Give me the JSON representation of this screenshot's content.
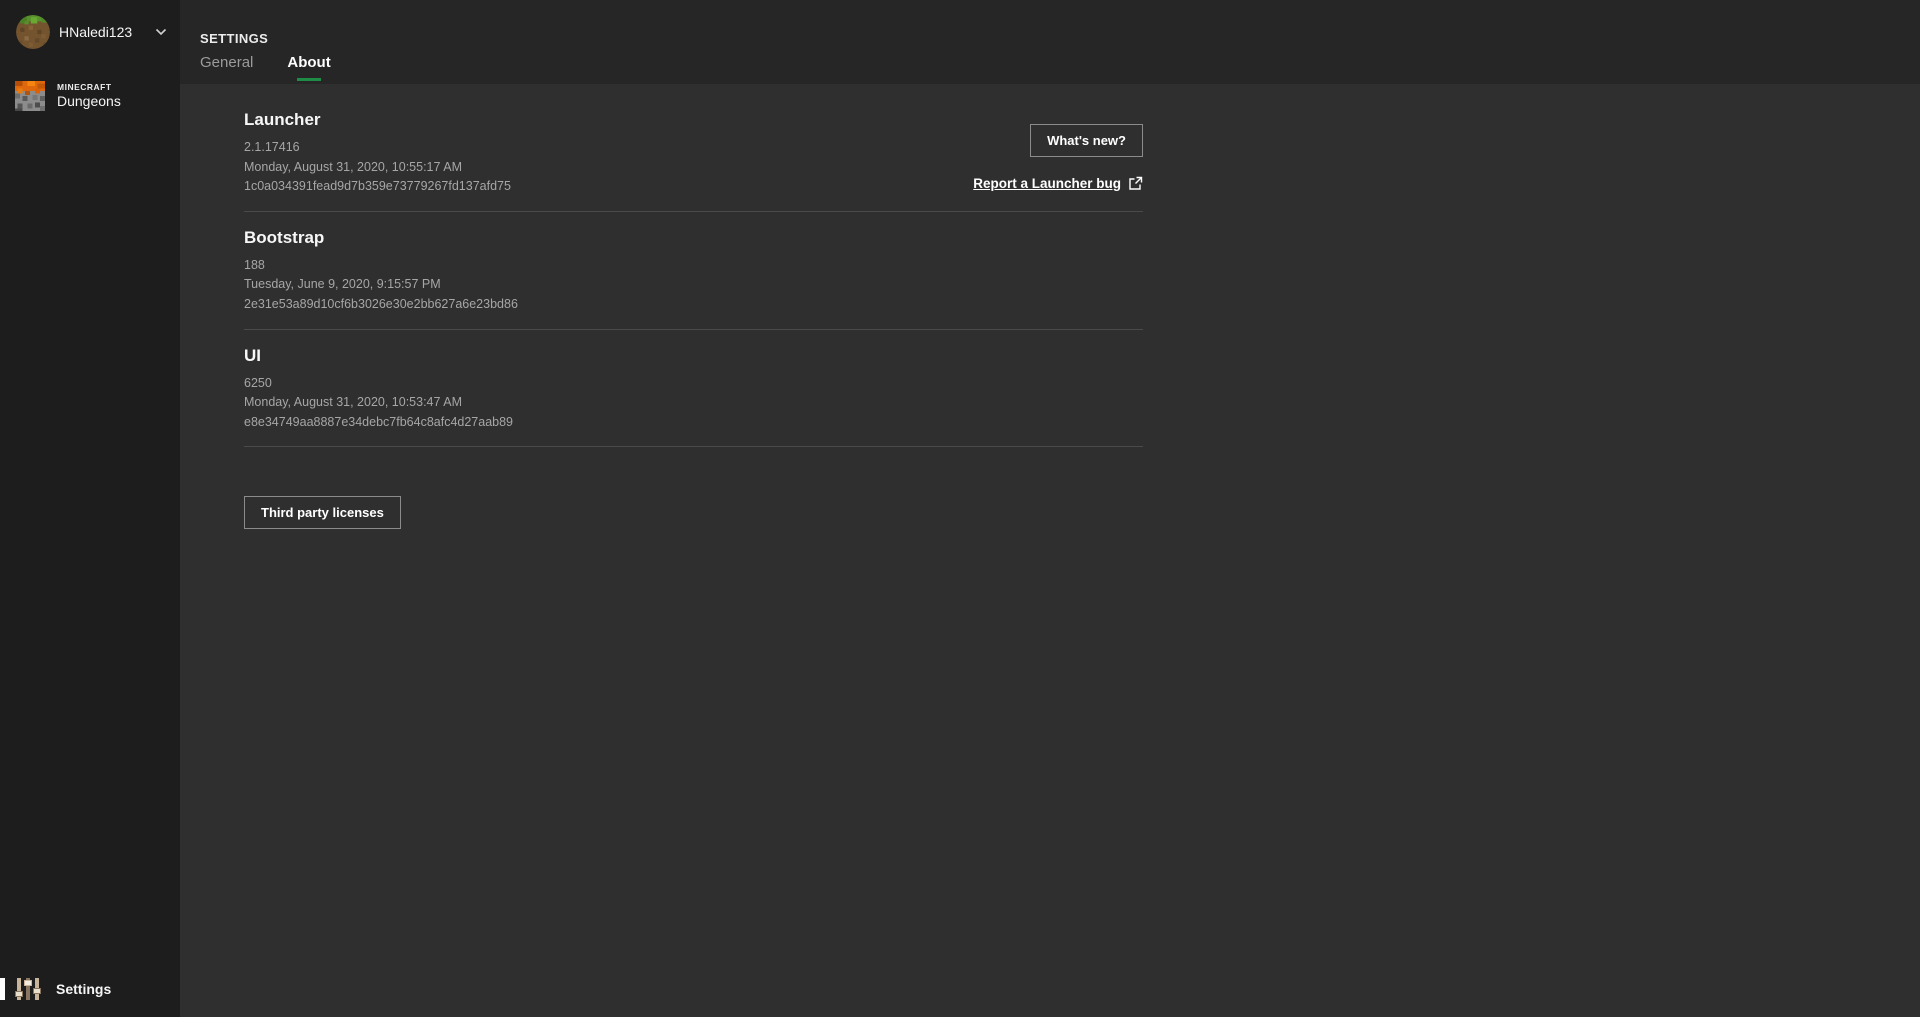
{
  "sidebar": {
    "profile": {
      "username": "HNaledi123"
    },
    "game": {
      "brand": "MINECRAFT",
      "name": "Dungeons"
    },
    "settings_label": "Settings"
  },
  "header": {
    "title": "SETTINGS",
    "tabs": [
      {
        "label": "General",
        "active": false
      },
      {
        "label": "About",
        "active": true
      }
    ]
  },
  "about": {
    "sections": [
      {
        "title": "Launcher",
        "version": "2.1.17416",
        "date": "Monday, August 31, 2020, 10:55:17 AM",
        "hash": "1c0a034391fead9d7b359e73779267fd137afd75"
      },
      {
        "title": "Bootstrap",
        "version": "188",
        "date": "Tuesday, June 9, 2020, 9:15:57 PM",
        "hash": "2e31e53a89d10cf6b3026e30e2bb627a6e23bd86"
      },
      {
        "title": "UI",
        "version": "6250",
        "date": "Monday, August 31, 2020, 10:53:47 AM",
        "hash": "e8e34749aa8887e34debc7fb64c8afc4d27aab89"
      }
    ],
    "whats_new_label": "What's new?",
    "report_bug_label": "Report a Launcher bug",
    "licenses_label": "Third party licenses"
  },
  "colors": {
    "accent_green": "#1e8b47",
    "sidebar_bg": "#1d1d1d",
    "header_bg": "#262626",
    "content_bg": "#2f2f2f"
  }
}
